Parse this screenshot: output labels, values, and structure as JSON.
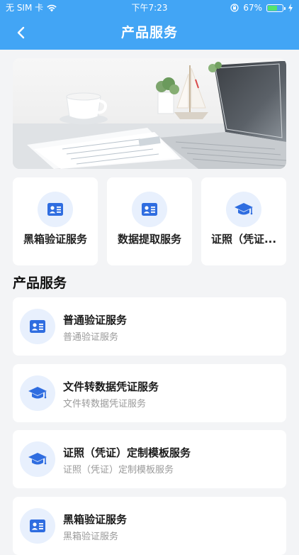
{
  "status_bar": {
    "carrier": "无 SIM 卡",
    "time": "下午7:23",
    "battery": "67%",
    "battery_level": 0.67
  },
  "nav": {
    "title": "产品服务"
  },
  "quick_tiles": [
    {
      "label": "黑箱验证服务",
      "icon": "id-card-icon"
    },
    {
      "label": "数据提取服务",
      "icon": "id-card-icon"
    },
    {
      "label": "证照（凭证...",
      "icon": "graduation-cap-icon"
    }
  ],
  "section": {
    "title": "产品服务"
  },
  "services": [
    {
      "title": "普通验证服务",
      "subtitle": "普通验证服务",
      "icon": "id-card-icon"
    },
    {
      "title": "文件转数据凭证服务",
      "subtitle": "文件转数据凭证服务",
      "icon": "graduation-cap-icon"
    },
    {
      "title": "证照（凭证）定制模板服务",
      "subtitle": "证照（凭证）定制模板服务",
      "icon": "graduation-cap-icon"
    },
    {
      "title": "黑箱验证服务",
      "subtitle": "黑箱验证服务",
      "icon": "id-card-icon"
    }
  ],
  "colors": {
    "header": "#42a5f5",
    "icon_bg": "#e8f0fd",
    "icon_fg": "#2f6de0"
  }
}
